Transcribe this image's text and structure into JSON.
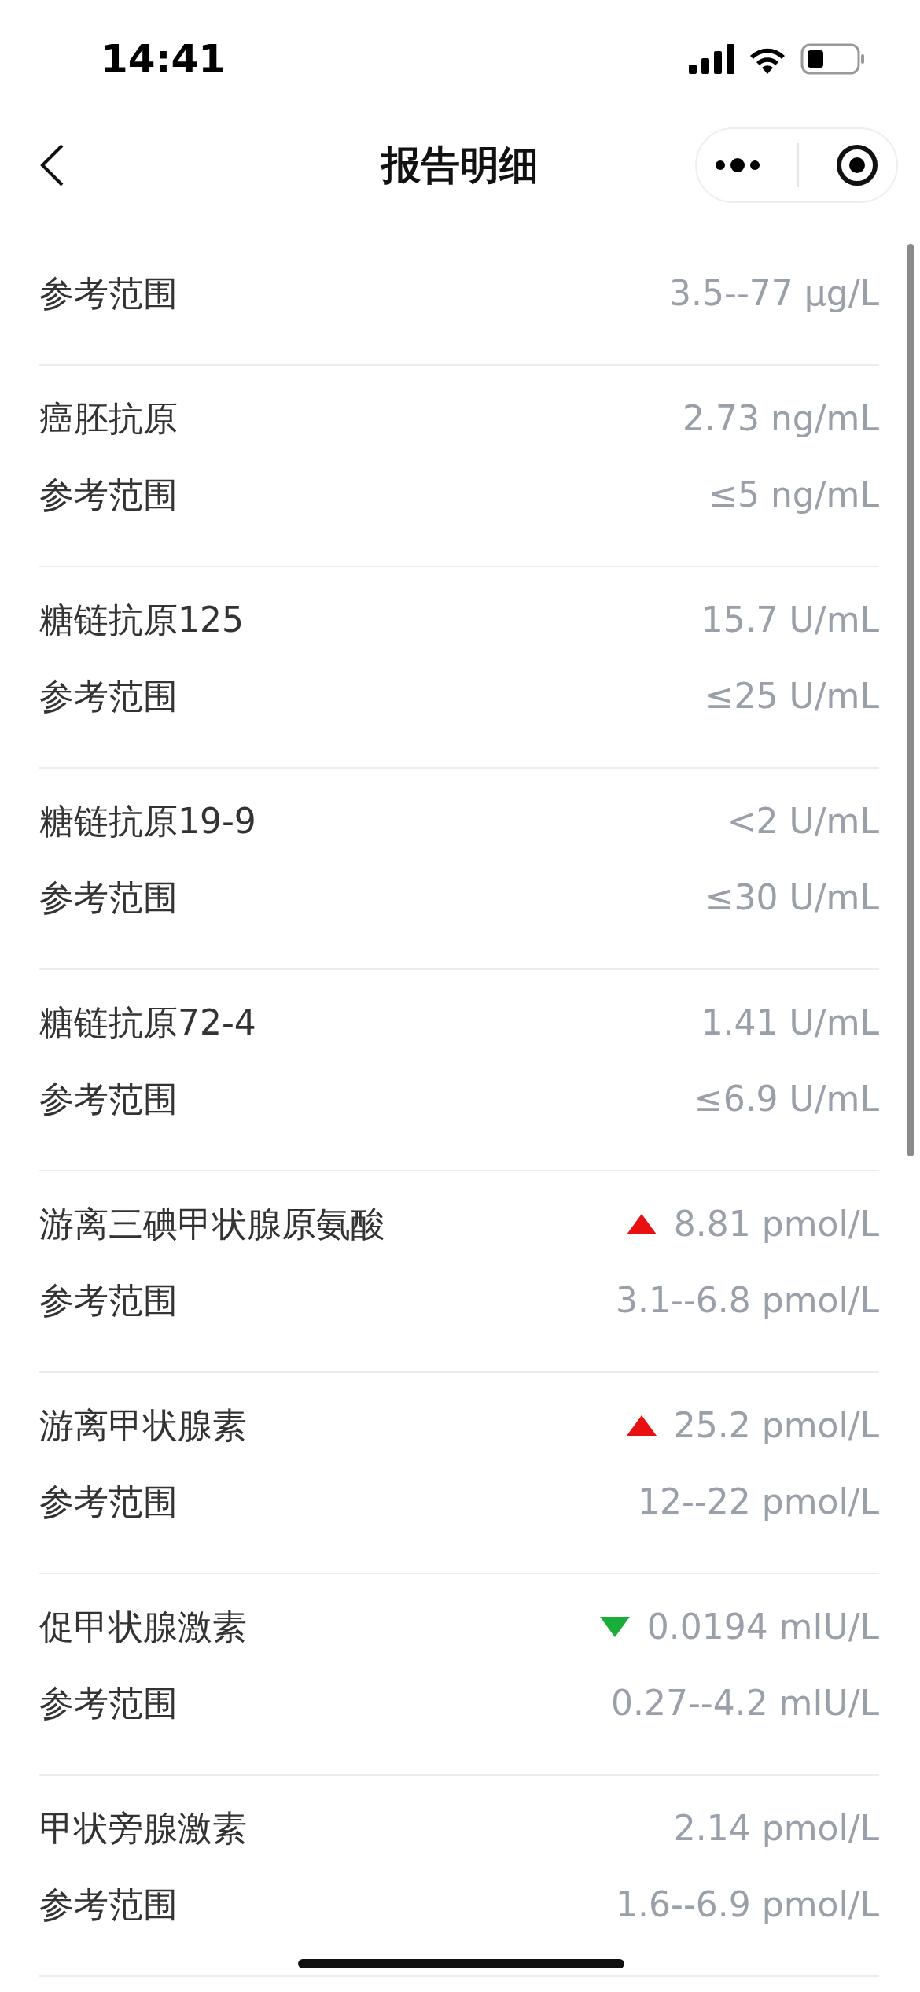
{
  "status_bar": {
    "time": "14:41"
  },
  "nav": {
    "title": "报告明细"
  },
  "items": [
    {
      "ref_label": "参考范围",
      "ref": "3.5--77 μg/L"
    },
    {
      "name": "癌胚抗原",
      "value": "2.73 ng/mL",
      "ref_label": "参考范围",
      "ref": "≤5 ng/mL"
    },
    {
      "name": "糖链抗原125",
      "value": "15.7 U/mL",
      "ref_label": "参考范围",
      "ref": "≤25 U/mL"
    },
    {
      "name": "糖链抗原19-9",
      "value": "<2 U/mL",
      "ref_label": "参考范围",
      "ref": "≤30 U/mL"
    },
    {
      "name": "糖链抗原72-4",
      "value": "1.41 U/mL",
      "ref_label": "参考范围",
      "ref": "≤6.9 U/mL"
    },
    {
      "name": "游离三碘甲状腺原氨酸",
      "value": "8.81 pmol/L",
      "high": true,
      "ref_label": "参考范围",
      "ref": "3.1--6.8 pmol/L"
    },
    {
      "name": "游离甲状腺素",
      "value": "25.2 pmol/L",
      "high": true,
      "ref_label": "参考范围",
      "ref": "12--22 pmol/L"
    },
    {
      "name": "促甲状腺激素",
      "value": "0.0194 mIU/L",
      "low": true,
      "ref_label": "参考范围",
      "ref": "0.27--4.2 mIU/L"
    },
    {
      "name": "甲状旁腺激素",
      "value": "2.14 pmol/L",
      "ref_label": "参考范围",
      "ref": "1.6--6.9 pmol/L"
    }
  ]
}
